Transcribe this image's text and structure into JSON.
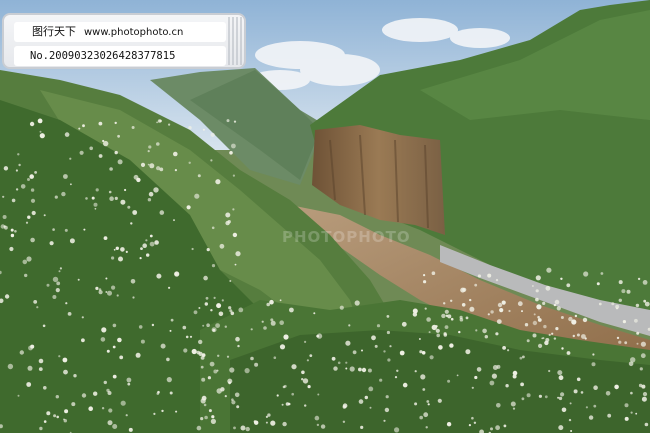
{
  "watermark": {
    "brand": "图行天下",
    "site": "www.photophoto.cn",
    "number": "No.20090323026428377815",
    "center_text": "PHOTOPHOTO"
  },
  "colors": {
    "sky": "#a9c4dd",
    "cliff": "#8a6a47",
    "river": "#9b7a55",
    "foliage": "#4f7a3a",
    "blossom": "#f1f1e6"
  }
}
